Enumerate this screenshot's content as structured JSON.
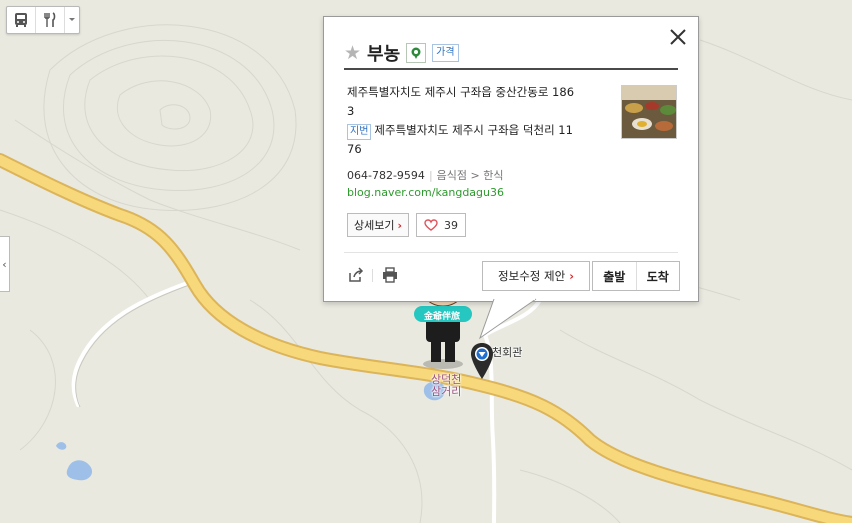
{
  "toolbar": {
    "icons": [
      "bus-icon",
      "restaurant-icon",
      "chevron-down-icon"
    ]
  },
  "side_panel": {
    "toggle_glyph": "‹"
  },
  "popup": {
    "name": "부농",
    "price_badge": "가격",
    "address_road_line1": "제주특별자치도 제주시 구좌읍 중산간동로 186",
    "address_road_line2": "3",
    "jibun_tag": "지번",
    "address_jibun_line1": "제주특별자치도 제주시 구좌읍 덕천리 11",
    "address_jibun_line2": "76",
    "phone": "064-782-9594",
    "category_main": "음식점",
    "category_arrow": ">",
    "category_sub": "한식",
    "blog_url": "blog.naver.com/kangdagu36",
    "detail_button": "상세보기",
    "like_count": "39",
    "suggest_button": "정보수정 제안",
    "depart_button": "출발",
    "arrive_button": "도착"
  },
  "map_labels": {
    "place": "천회관",
    "intersection_line1": "상덕천",
    "intersection_line2": "삼거리",
    "character_badge": "金爺伴旅"
  },
  "colors": {
    "map_bg": "#e9e9e0",
    "road": "#f5d77a",
    "water": "#9ec0e8",
    "link_green": "#2f9a2f",
    "accent_red": "#d9262b"
  }
}
